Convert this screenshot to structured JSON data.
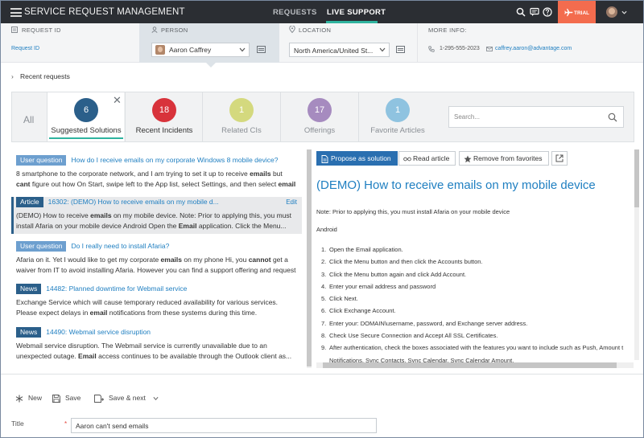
{
  "header": {
    "app_title": "SERVICE REQUEST MANAGEMENT",
    "nav": [
      "REQUESTS",
      "LIVE SUPPORT"
    ],
    "active_nav": "LIVE SUPPORT",
    "trial_label": "TRIAL",
    "icons": [
      "menu-icon",
      "search-icon",
      "chat-icon",
      "help-icon",
      "airplane-icon",
      "chevron-down-icon"
    ],
    "accent_color": "#2fb39f",
    "trial_color": "#f36c4e"
  },
  "context": {
    "request_id": {
      "label": "REQUEST ID",
      "value": "Request ID"
    },
    "person": {
      "label": "PERSON",
      "value": "Aaron Caffrey"
    },
    "location": {
      "label": "LOCATION",
      "value": "North America/United St..."
    },
    "more_info": {
      "label": "MORE INFO:",
      "phone": "1-295-555-2023",
      "email": "caffrey.aaron@advantage.com"
    }
  },
  "recent_requests": "Recent requests",
  "tabs": {
    "all_label": "All",
    "items": [
      {
        "count": "6",
        "label": "Suggested Solutions",
        "color": "#2b5f8a",
        "active": true
      },
      {
        "count": "18",
        "label": "Recent Incidents",
        "color": "#d8333b",
        "active": false
      },
      {
        "count": "1",
        "label": "Related CIs",
        "color": "#d4d97e",
        "active": false
      },
      {
        "count": "17",
        "label": "Offerings",
        "color": "#a68bbf",
        "active": false
      },
      {
        "count": "1",
        "label": "Favorite Articles",
        "color": "#8fc3e0",
        "active": false
      }
    ],
    "search_placeholder": "Search..."
  },
  "results": [
    {
      "badge": "User question",
      "title": "How do I receive emails on my corporate Windows 8 mobile device?",
      "body": "8 smartphone to the corporate network, and I am trying to set it up to receive emails but cant figure out how On Start, swipe left to the App list, select Settings, and then select email"
    },
    {
      "badge": "Article",
      "title": "16302:  (DEMO) How to receive emails on my mobile d...",
      "edit": "Edit",
      "body": "(DEMO) How to receive emails on my mobile device. Note: Prior to applying this, you must install Afaria on your mobile device Android Open the Email application. Click the Menu..."
    },
    {
      "badge": "User question",
      "title": "Do I really need to install Afaria?",
      "body": "Afaria on it. Yet I would like to get my corporate emails on my phone Hi, you cannot get a waiver from IT to avoid installing Afaria. However you can find a support offering and request"
    },
    {
      "badge": "News",
      "title": "14482:  Planned downtime for Webmail service",
      "body": "Exchange Service which will cause temporary reduced availability for various services. Please expect delays in email notifications from these systems during this time."
    },
    {
      "badge": "News",
      "title": "14490:  Webmail service disruption",
      "body": "Webmail service disruption. The Webmail service is currently unavailable due to an unexpected outage. Email access continues to be available through the Outlook client as..."
    }
  ],
  "detail": {
    "buttons": {
      "propose": "Propose as solution",
      "read": "Read article",
      "remove": "Remove from favorites"
    },
    "title": "(DEMO) How to receive emails on my mobile device",
    "note": "Note: Prior to applying this, you must install Afaria on your mobile device",
    "platform": "Android",
    "steps": [
      "Open the Email application.",
      "Click the Menu button and then click the Accounts button.",
      "Click the Menu button again and click Add Account.",
      "Enter your email address and password",
      "Click Next.",
      "Click Exchange Account.",
      "Enter your: DOMAIN\\username, password, and Exchange server address.",
      "Check Use Secure Connection and Accept All SSL Certificates.",
      "After authentication, check the boxes associated with the features you want to include such as Push, Amount t",
      "Notifications, Sync Contacts, Sync Calendar, Sync Calendar Amount."
    ]
  },
  "actions": {
    "new": "New",
    "save": "Save",
    "save_next": "Save & next"
  },
  "form": {
    "title_label": "Title",
    "required_mark": "*",
    "title_value": "Aaron can't send emails"
  }
}
